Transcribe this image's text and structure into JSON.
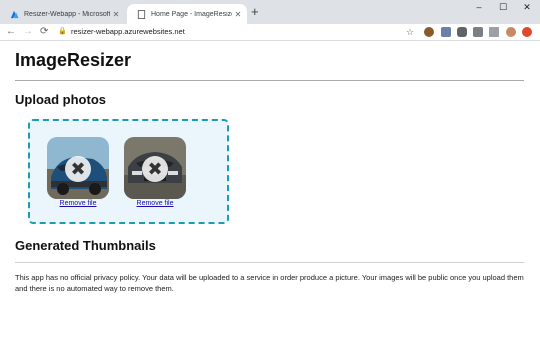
{
  "browser": {
    "tabs": [
      {
        "title": "Resizer-Webapp - Microsoft Azure",
        "active": false,
        "icon": "azure-icon"
      },
      {
        "title": "Home Page - ImageResizeWebApp",
        "active": true,
        "icon": "page-icon"
      }
    ],
    "new_tab": "+",
    "window_controls": {
      "minimize": "–",
      "maximize": "☐",
      "close": "✕"
    },
    "url": "resizer-webapp.azurewebsites.net",
    "nav": {
      "back": "←",
      "forward": "→",
      "reload": "⟳"
    },
    "star": "☆",
    "menu": "⋮"
  },
  "page": {
    "title": "ImageResizer",
    "upload_heading": "Upload photos",
    "previews": [
      {
        "remove_label": "Remove file",
        "error_mark": "✖"
      },
      {
        "remove_label": "Remove file",
        "error_mark": "✖"
      }
    ],
    "thumbnails_heading": "Generated Thumbnails",
    "policy_text": "This app has no official privacy policy. Your data will be uploaded to a service in order produce a picture. Your images will be public once you upload them and there is no automated way to remove them."
  },
  "colors": {
    "dropzone_border": "#1a9cb3",
    "dropzone_bg": "#eaf6fb",
    "link": "#1a0dab"
  }
}
